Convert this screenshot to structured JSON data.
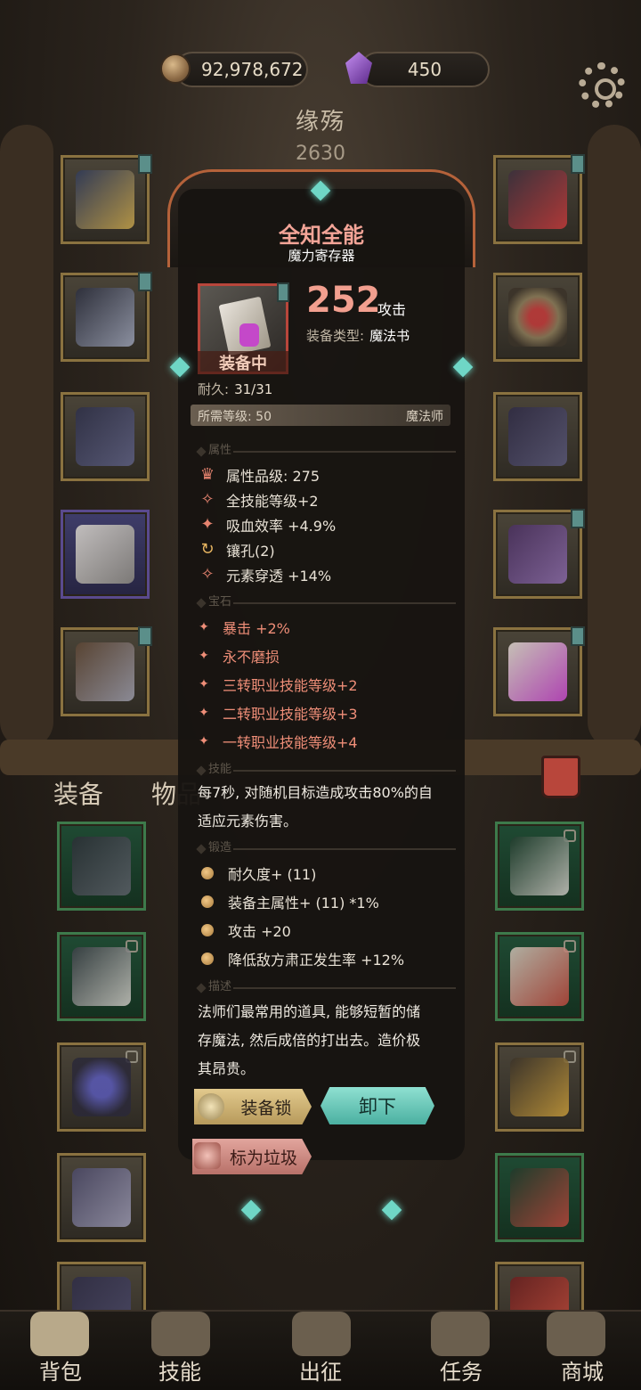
{
  "currency": {
    "gold": "92,978,672",
    "gems": "450"
  },
  "character": {
    "name": "缘殇",
    "power": "2630"
  },
  "tabs": {
    "equipment": "装备",
    "items": "物品"
  },
  "item": {
    "name": "全知全能",
    "subtitle": "魔力寄存器",
    "attack_value": "252",
    "attack_label": "攻击",
    "type_label": "装备类型:",
    "type_value": "魔法书",
    "equipped_label": "装备中",
    "durability_label": "耐久:",
    "durability_value": "31/31",
    "req_level": "所需等级: 50",
    "req_class": "魔法师"
  },
  "sections": {
    "attributes": "属性",
    "gems": "宝石",
    "skill": "技能",
    "forge": "锻造",
    "description": "描述"
  },
  "attributes": [
    {
      "icon": "quality-icon",
      "text": "属性品级: 275"
    },
    {
      "icon": "skill-level-icon",
      "text": "全技能等级+2"
    },
    {
      "icon": "lifesteal-icon",
      "text": "吸血效率 +4.9%"
    },
    {
      "icon": "socket-icon",
      "text": "镶孔(2)"
    },
    {
      "icon": "penetration-icon",
      "text": "元素穿透 +14%"
    }
  ],
  "gems": [
    "暴击 +2%",
    "永不磨损",
    "三转职业技能等级+2",
    "二转职业技能等级+3",
    "一转职业技能等级+4"
  ],
  "skill": {
    "line1": "每7秒, 对随机目标造成攻击80%的自",
    "line2": "适应元素伤害。"
  },
  "forge": [
    "耐久度+ (11)",
    "装备主属性+ (11) *1%",
    "攻击 +20",
    "降低敌方肃正发生率 +12%"
  ],
  "description": {
    "line1": "法师们最常用的道具, 能够短暂的储",
    "line2": "存魔法, 然后成倍的打出去。造价极",
    "line3": "其昂贵。"
  },
  "buttons": {
    "lock": "装备锁",
    "unequip": "卸下",
    "mark_trash": "标为垃圾"
  },
  "nav": {
    "backpack": "背包",
    "skills": "技能",
    "expedition": "出征",
    "quests": "任务",
    "shop": "商城"
  },
  "colors": {
    "title": "#f3a497",
    "attack": "#f29f8f",
    "gem_text": "#ef8e78",
    "unequip_button": "#6fd0c1",
    "lock_button": "#d4b877",
    "trash_button": "#d08e86"
  }
}
